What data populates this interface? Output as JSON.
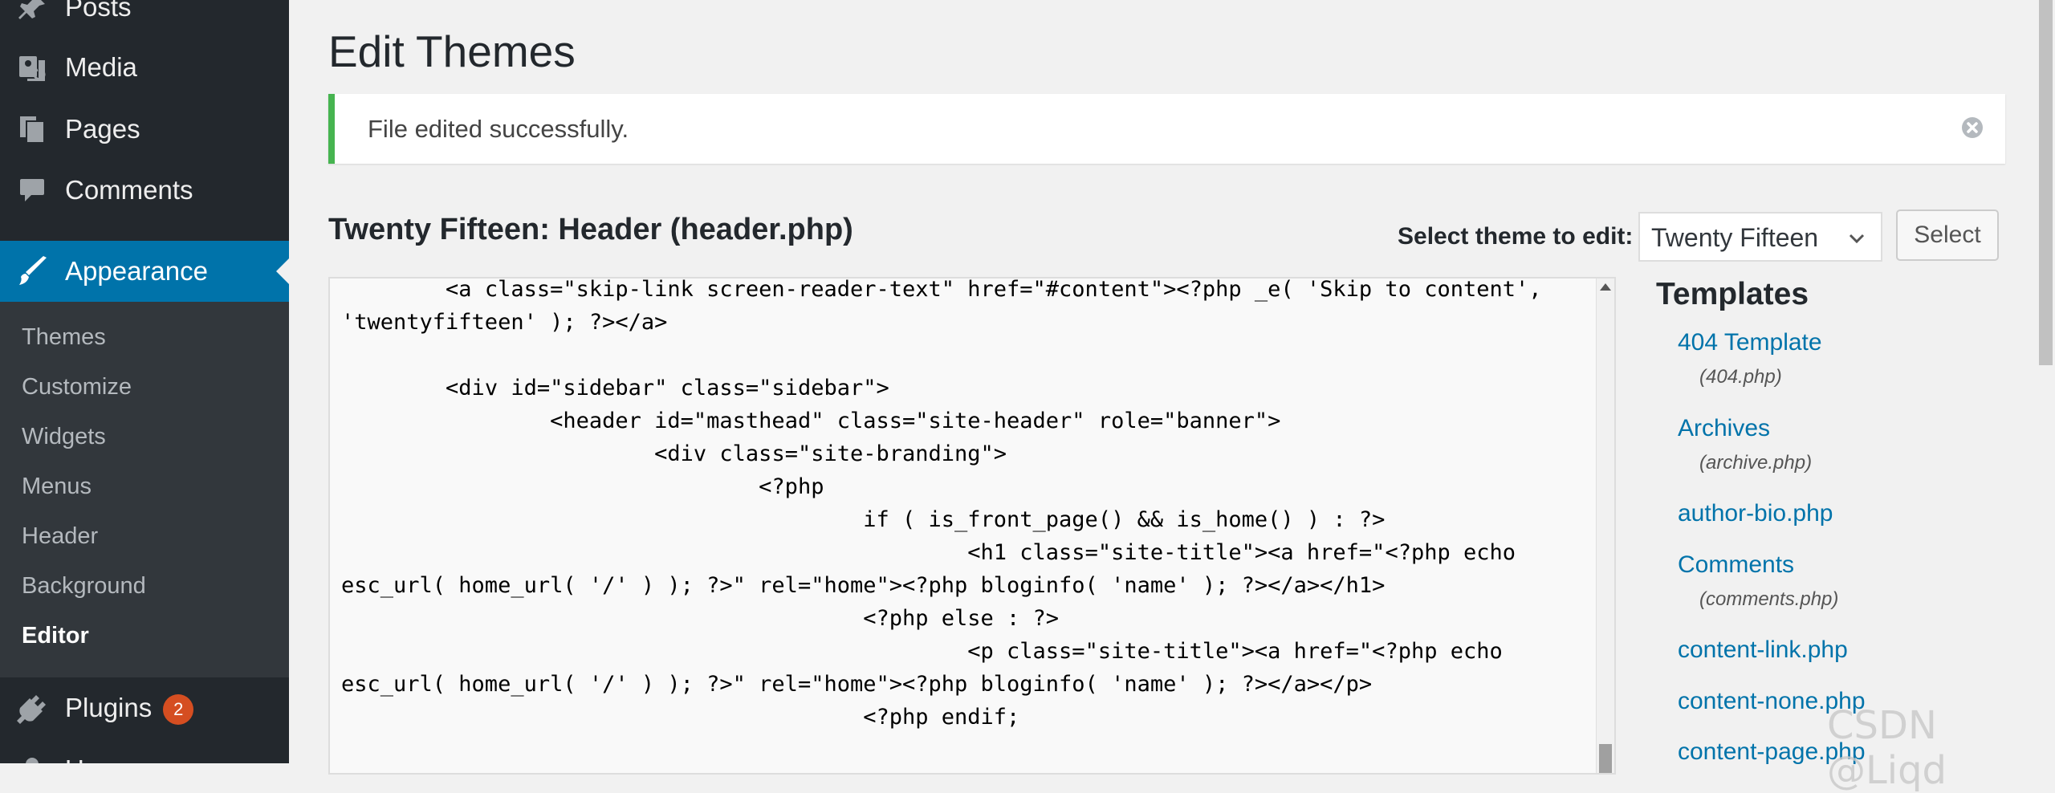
{
  "sidebar": {
    "menu": {
      "posts": "Posts",
      "media": "Media",
      "pages": "Pages",
      "comments": "Comments",
      "appearance": "Appearance",
      "plugins": "Plugins",
      "plugins_badge": "2",
      "users": "Users"
    },
    "submenu": [
      "Themes",
      "Customize",
      "Widgets",
      "Menus",
      "Header",
      "Background",
      "Editor"
    ],
    "current_submenu": "Editor"
  },
  "page": {
    "title": "Edit Themes",
    "notice": "File edited successfully.",
    "file_title": "Twenty Fifteen: Header (header.php)",
    "select_label": "Select theme to edit:",
    "selected_theme": "Twenty Fifteen",
    "select_button": "Select"
  },
  "editor": {
    "code": "\t<a class=\"skip-link screen-reader-text\" href=\"#content\"><?php _e( 'Skip to content',\n'twentyfifteen' ); ?></a>\n\n\t<div id=\"sidebar\" class=\"sidebar\">\n\t\t<header id=\"masthead\" class=\"site-header\" role=\"banner\">\n\t\t\t<div class=\"site-branding\">\n\t\t\t\t<?php\n\t\t\t\t\tif ( is_front_page() && is_home() ) : ?>\n\t\t\t\t\t\t<h1 class=\"site-title\"><a href=\"<?php echo\nesc_url( home_url( '/' ) ); ?>\" rel=\"home\"><?php bloginfo( 'name' ); ?></a></h1>\n\t\t\t\t\t<?php else : ?>\n\t\t\t\t\t\t<p class=\"site-title\"><a href=\"<?php echo\nesc_url( home_url( '/' ) ); ?>\" rel=\"home\"><?php bloginfo( 'name' ); ?></a></p>\n\t\t\t\t\t<?php endif;"
  },
  "templates": {
    "heading": "Templates",
    "items": [
      {
        "label": "404 Template",
        "file": "(404.php)"
      },
      {
        "label": "Archives",
        "file": "(archive.php)"
      },
      {
        "label": "author-bio.php",
        "file": ""
      },
      {
        "label": "Comments",
        "file": "(comments.php)"
      },
      {
        "label": "content-link.php",
        "file": ""
      },
      {
        "label": "content-none.php",
        "file": ""
      },
      {
        "label": "content-page.php",
        "file": ""
      }
    ]
  },
  "watermark": "CSDN @Liqd",
  "colors": {
    "sidebar_bg": "#23282d",
    "submenu_bg": "#32373c",
    "accent": "#0073aa",
    "notice_success": "#46b450",
    "badge": "#d54e21"
  },
  "icons": {
    "posts": "pin-icon",
    "media": "media-icon",
    "pages": "pages-icon",
    "comments": "comment-icon",
    "appearance": "brush-icon",
    "plugins": "plug-icon",
    "users": "user-icon"
  }
}
